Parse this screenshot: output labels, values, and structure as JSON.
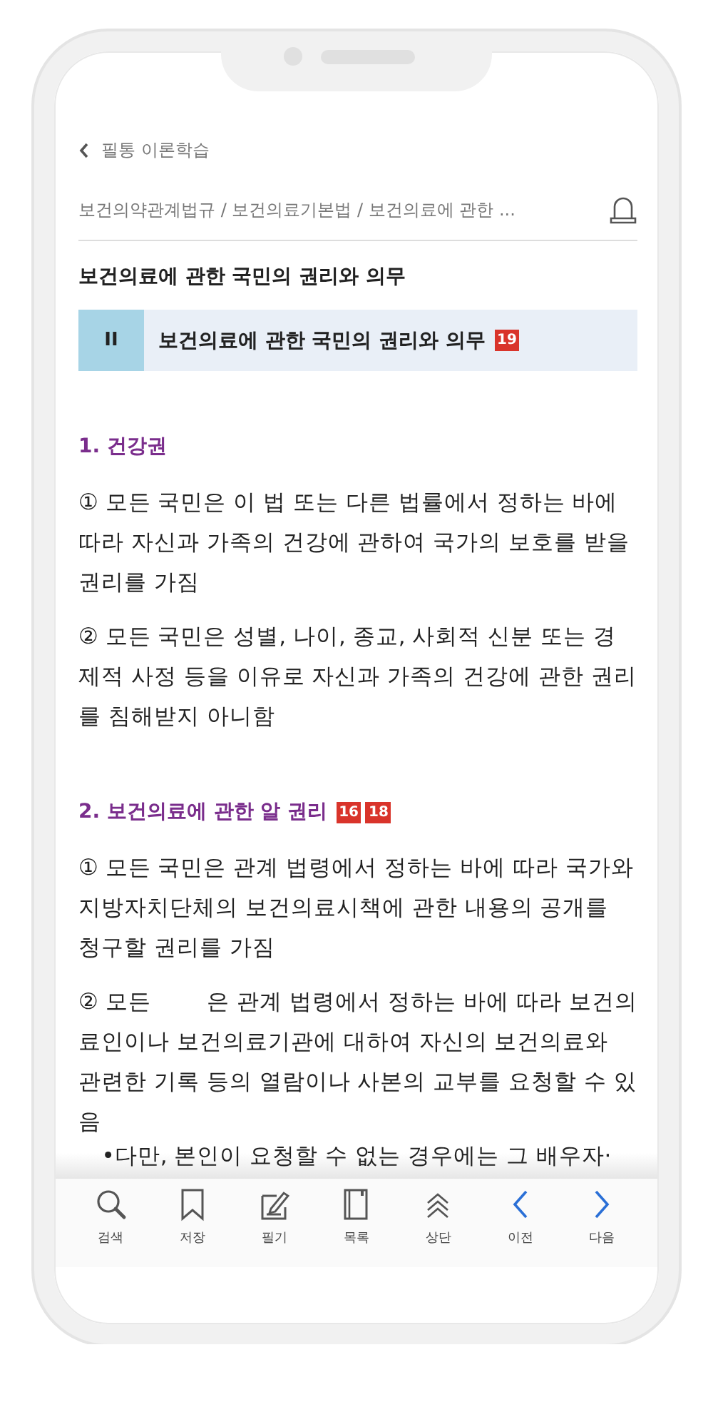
{
  "header": {
    "back_label": "필통 이론학습",
    "breadcrumb": "보건의약관계법규 / 보건의료기본법 / 보건의료에 관한 ..."
  },
  "page_title": "보건의료에 관한 국민의 권리와 의무",
  "section": {
    "number": "II",
    "title": "보건의료에 관한 국민의 권리와 의무",
    "badges": [
      "19"
    ]
  },
  "blocks": [
    {
      "heading": "1. 건강권",
      "paragraphs": [
        "① 모든 국민은 이 법 또는 다른 법률에서 정하는 바에 따라 자신과 가족의 건강에 관하여 국가의 보호를 받을 권리를 가짐",
        "② 모든 국민은 성별, 나이, 종교, 사회적 신분 또는 경제적 사정 등을 이유로 자신과 가족의 건강에 관한 권리를 침해받지 아니함"
      ]
    },
    {
      "heading": "2. 보건의료에 관한 알 권리",
      "badges": [
        "16",
        "18"
      ],
      "paragraphs": [
        "① 모든 국민은 관계 법령에서 정하는 바에 따라 국가와 지방자치단체의 보건의료시책에 관한 내용의 공개를 청구할 권리를 가짐",
        "② 모든        은 관계 법령에서 정하는 바에 따라 보건의료인이나 보건의료기관에 대하여 자신의 보건의료와 관련한 기록 등의 열람이나 사본의 교부를 요청할 수 있음"
      ]
    }
  ],
  "cut_line": "•다만, 본인이 요청할 수 없는 경우에는 그 배우자·",
  "toolbar": [
    {
      "label": "검색"
    },
    {
      "label": "저장"
    },
    {
      "label": "필기"
    },
    {
      "label": "목록"
    },
    {
      "label": "상단"
    },
    {
      "label": "이전"
    },
    {
      "label": "다음"
    }
  ]
}
